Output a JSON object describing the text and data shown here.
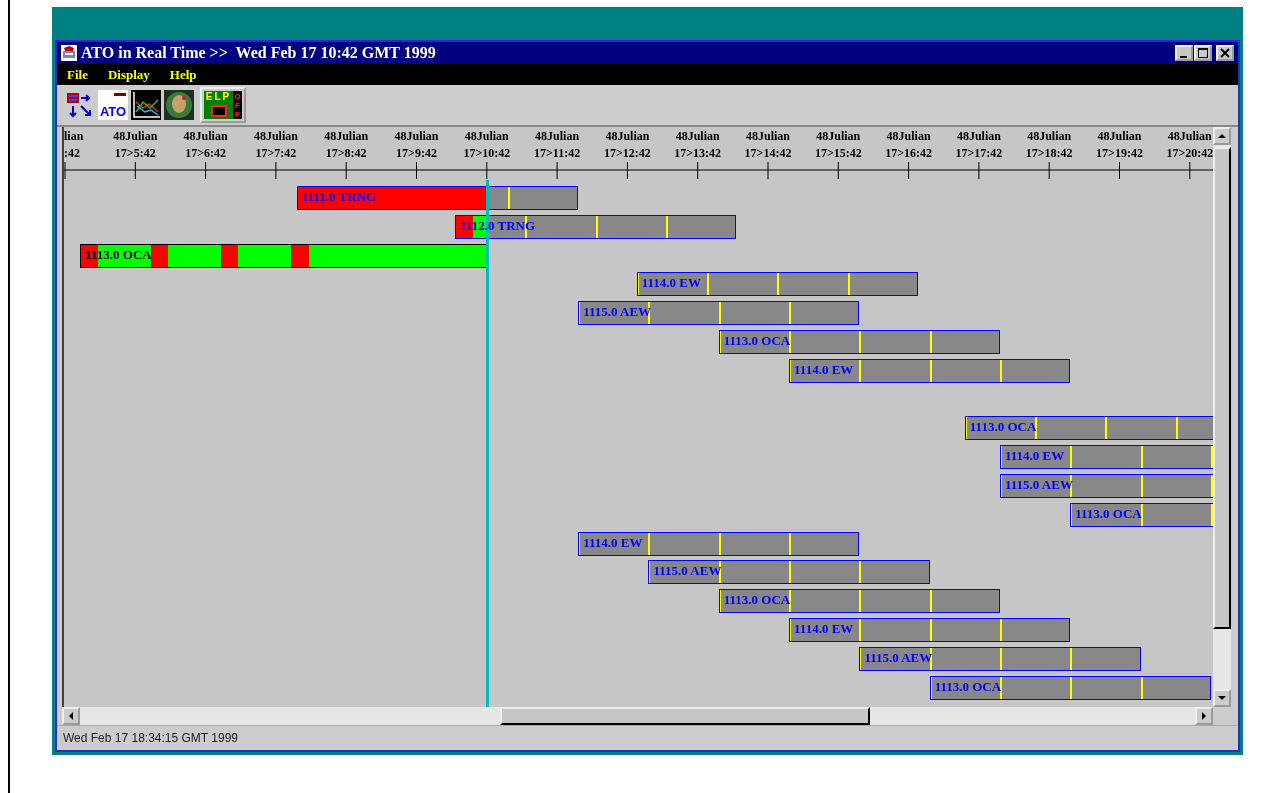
{
  "window": {
    "title": "ATO in Real Time >>  Wed Feb 17 10:42 GMT 1999"
  },
  "menu": [
    "File",
    "Display",
    "Help"
  ],
  "toolbar": [
    {
      "kind": "arrows"
    },
    {
      "kind": "ato",
      "label": "ATO"
    },
    {
      "kind": "chart"
    },
    {
      "kind": "sphere"
    },
    {
      "kind": "elp",
      "label": "ELP",
      "state_label": "OFF"
    }
  ],
  "timeline": {
    "ticks": [
      {
        "date": "lian",
        "time": ":42"
      },
      {
        "date": "48Julian",
        "time": "17>5:42"
      },
      {
        "date": "48Julian",
        "time": "17>6:42"
      },
      {
        "date": "48Julian",
        "time": "17>7:42"
      },
      {
        "date": "48Julian",
        "time": "17>8:42"
      },
      {
        "date": "48Julian",
        "time": "17>9:42"
      },
      {
        "date": "48Julian",
        "time": "17>10:42"
      },
      {
        "date": "48Julian",
        "time": "17>11:42"
      },
      {
        "date": "48Julian",
        "time": "17>12:42"
      },
      {
        "date": "48Julian",
        "time": "17>13:42"
      },
      {
        "date": "48Julian",
        "time": "17>14:42"
      },
      {
        "date": "48Julian",
        "time": "17>15:42"
      },
      {
        "date": "48Julian",
        "time": "17>16:42"
      },
      {
        "date": "48Julian",
        "time": "17>17:42"
      },
      {
        "date": "48Julian",
        "time": "17>18:42"
      },
      {
        "date": "48Julian",
        "time": "17>19:42"
      },
      {
        "date": "48Julian",
        "time": "17>20:42"
      }
    ]
  },
  "rows": [
    {
      "kind": "bar",
      "label": "1111.0 TRNG",
      "selected": false,
      "segments": [
        {
          "color": "#ff0000"
        }
      ]
    },
    {
      "kind": "bar",
      "label": "1112.0 TRNG",
      "selected": false,
      "segments": [
        {
          "color": "#ff0000"
        },
        {
          "color": "#00ff00"
        }
      ]
    },
    {
      "kind": "bar",
      "label": "1113.0 OCA",
      "selected": true,
      "segments": [
        {
          "color": "#ff0000"
        },
        {
          "color": "#00ff00"
        },
        {
          "color": "#ff0000"
        },
        {
          "color": "#00ff00"
        },
        {
          "color": "#ff0000"
        },
        {
          "color": "#00ff00"
        },
        {
          "color": "#ff0000"
        },
        {
          "color": "#00ff00"
        }
      ]
    },
    {
      "kind": "bar",
      "label": "1114.0 EW",
      "selected": false
    },
    {
      "kind": "bar",
      "label": "1115.0 AEW",
      "selected": false
    },
    {
      "kind": "bar",
      "label": "1113.0 OCA",
      "selected": false
    },
    {
      "kind": "bar",
      "label": "1114.0 EW",
      "selected": false
    },
    {
      "kind": "empty"
    },
    {
      "kind": "bar",
      "label": "1113.0 OCA",
      "selected": false
    },
    {
      "kind": "bar",
      "label": "1114.0 EW",
      "selected": false
    },
    {
      "kind": "bar",
      "label": "1115.0 AEW",
      "selected": false
    },
    {
      "kind": "bar",
      "label": "1113.0 OCA",
      "selected": false
    },
    {
      "kind": "bar",
      "label": "1114.0 EW",
      "selected": false
    },
    {
      "kind": "bar",
      "label": "1115.0 AEW",
      "selected": false
    },
    {
      "kind": "bar",
      "label": "1113.0 OCA",
      "selected": false
    },
    {
      "kind": "bar",
      "label": "1114.0 EW",
      "selected": false
    },
    {
      "kind": "bar",
      "label": "1115.0 AEW",
      "selected": false
    },
    {
      "kind": "bar",
      "label": "1113.0 OCA",
      "selected": false
    }
  ],
  "status_bar": "Wed Feb 17 18:34:15 GMT 1999"
}
